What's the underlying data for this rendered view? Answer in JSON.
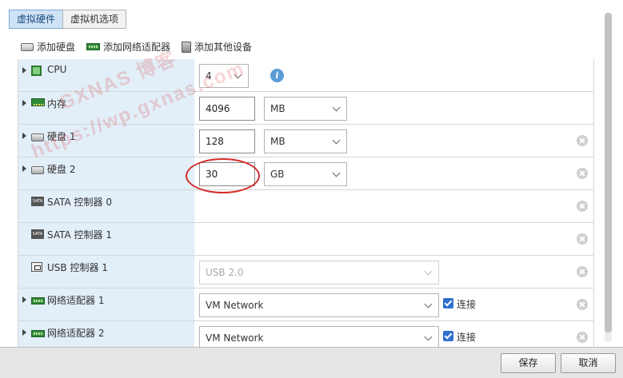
{
  "tabs": [
    {
      "label": "虚拟硬件",
      "active": true
    },
    {
      "label": "虚拟机选项",
      "active": false
    }
  ],
  "toolbar": {
    "add_disk": "添加硬盘",
    "add_nic": "添加网络适配器",
    "add_other": "添加其他设备"
  },
  "rows": {
    "cpu": {
      "label": "CPU",
      "value": "4"
    },
    "memory": {
      "label": "内存",
      "value": "4096",
      "unit": "MB"
    },
    "disk1": {
      "label": "硬盘 1",
      "value": "128",
      "unit": "MB"
    },
    "disk2": {
      "label": "硬盘 2",
      "value": "30",
      "unit": "GB"
    },
    "sata0": {
      "label": "SATA 控制器 0"
    },
    "sata1": {
      "label": "SATA 控制器 1"
    },
    "usb1": {
      "label": "USB 控制器 1",
      "value": "USB 2.0",
      "disabled": true
    },
    "nic1": {
      "label": "网络适配器 1",
      "value": "VM Network",
      "connect_label": "连接",
      "connected": true
    },
    "nic2": {
      "label": "网络适配器 2",
      "value": "VM Network",
      "connect_label": "连接",
      "connected": true
    }
  },
  "icons": {
    "sata_text": "SATA",
    "info_text": "i"
  },
  "watermark": {
    "line1": "GXNAS 博客",
    "line2": "https://wp.gxnas.com"
  },
  "footer": {
    "save": "保存",
    "cancel": "取消"
  },
  "colors": {
    "label_column_bg": "#e2eef8",
    "active_tab_bg": "#cfe3f7",
    "highlight_circle": "#d42a2a",
    "checkbox": "#2e6fd0",
    "info_icon": "#5b9bd5"
  }
}
